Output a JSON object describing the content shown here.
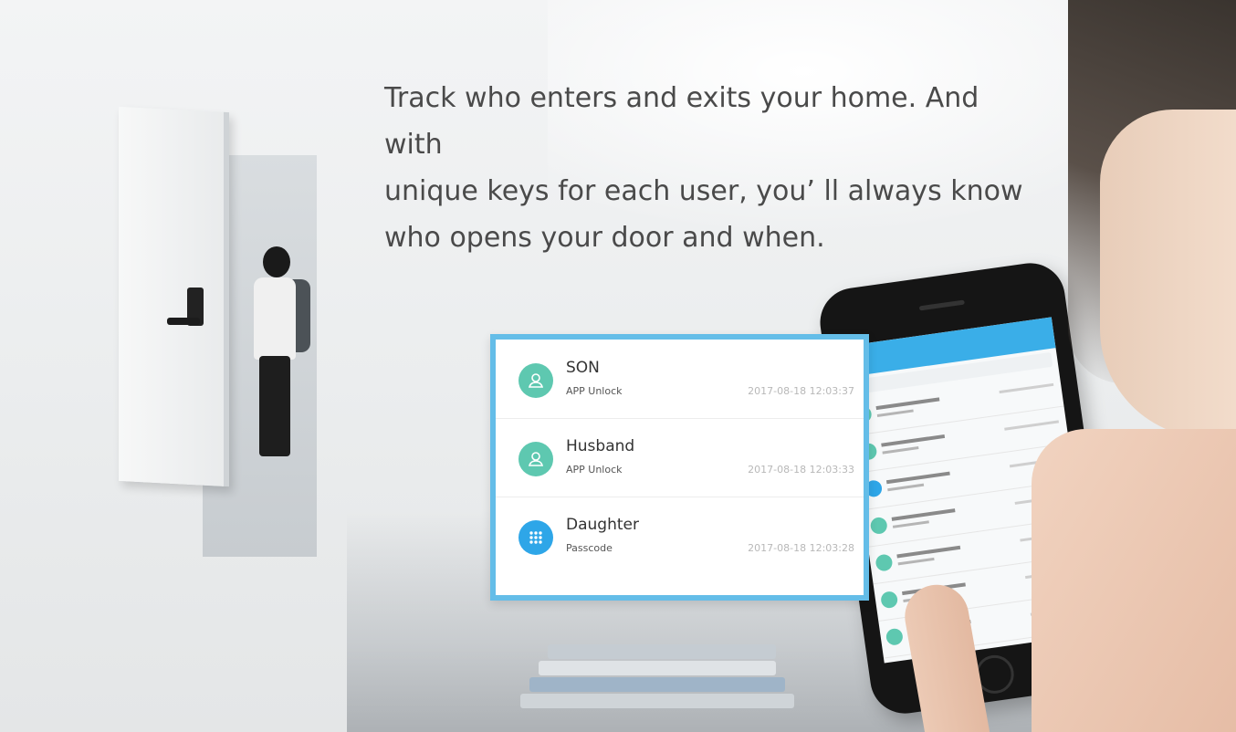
{
  "headline": "Track who enters and exits your home. And with\nunique keys for each user, you’  ll always know\nwho opens your door and when.",
  "history": [
    {
      "name": "SON",
      "method": "APP Unlock",
      "time": "2017-08-18 12:03:37",
      "icon": "user-icon"
    },
    {
      "name": "Husband",
      "method": "APP Unlock",
      "time": "2017-08-18 12:03:33",
      "icon": "user-icon"
    },
    {
      "name": "Daughter",
      "method": "Passcode",
      "time": "2017-08-18 12:03:28",
      "icon": "keypad-icon"
    }
  ],
  "colors": {
    "card_border": "#64bde8",
    "user_avatar": "#5ec8b0",
    "passcode_avatar": "#2ea6e8",
    "text": "#4a4a4a"
  }
}
